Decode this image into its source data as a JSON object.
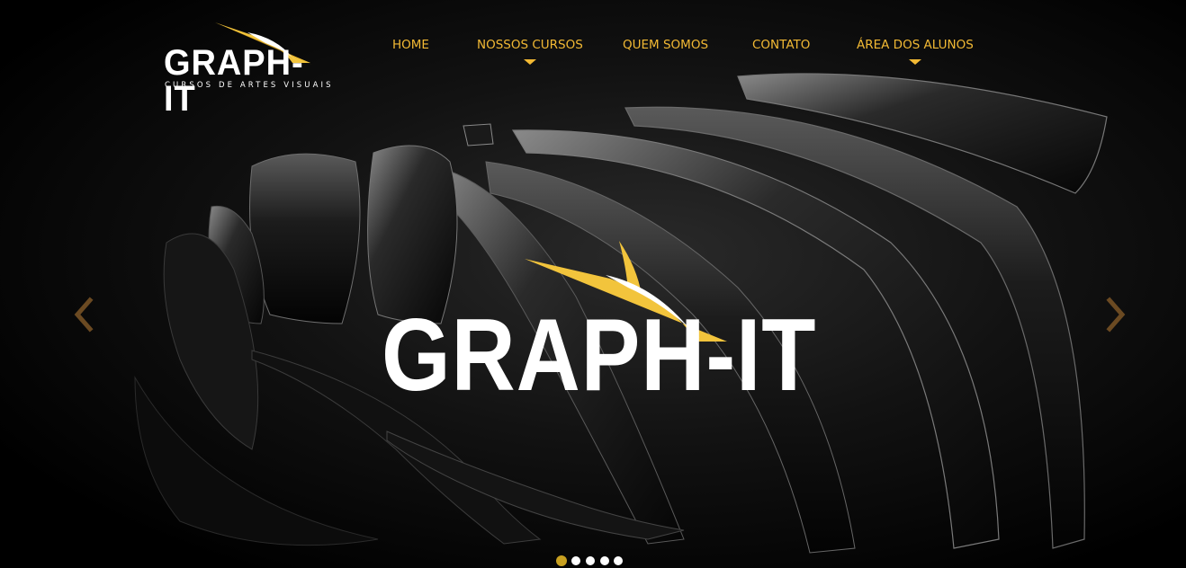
{
  "brand": {
    "name": "GRAPH-IT",
    "tagline": "CURSOS DE ARTES VISUAIS",
    "accent_color": "#f2b934"
  },
  "nav": {
    "items": [
      {
        "label": "HOME",
        "has_dropdown": false
      },
      {
        "label": "NOSSOS CURSOS",
        "has_dropdown": true
      },
      {
        "label": "QUEM SOMOS",
        "has_dropdown": false
      },
      {
        "label": "CONTATO",
        "has_dropdown": false
      },
      {
        "label": "ÁREA DOS ALUNOS",
        "has_dropdown": true
      }
    ]
  },
  "slider": {
    "headline": "GRAPH-IT",
    "prev_icon": "chevron-left-icon",
    "next_icon": "chevron-right-icon",
    "slide_count": 5,
    "active_slide": 1
  }
}
